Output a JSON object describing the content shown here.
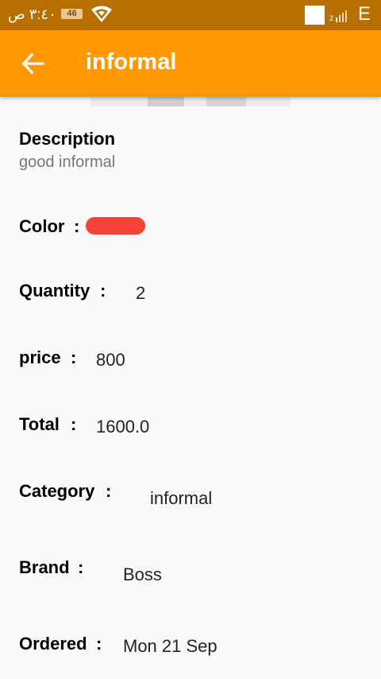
{
  "status_bar": {
    "time": "٣:٤٠ ص",
    "battery": "46",
    "network": "E",
    "signal_label": "2"
  },
  "app_bar": {
    "title": "informal",
    "back_icon": "arrow-left-icon"
  },
  "details": {
    "description_label": "Description",
    "description_value": "good informal",
    "color_label": "Color",
    "color_value": "#f44336",
    "quantity_label": "Quantity",
    "quantity_value": "2",
    "price_label": "price",
    "price_value": "800",
    "total_label": "Total",
    "total_value": "1600.0",
    "category_label": "Category",
    "category_value": "informal",
    "brand_label": "Brand",
    "brand_value": "Boss",
    "ordered_label": "Ordered",
    "ordered_value": "Mon 21 Sep",
    "colon": ":"
  }
}
